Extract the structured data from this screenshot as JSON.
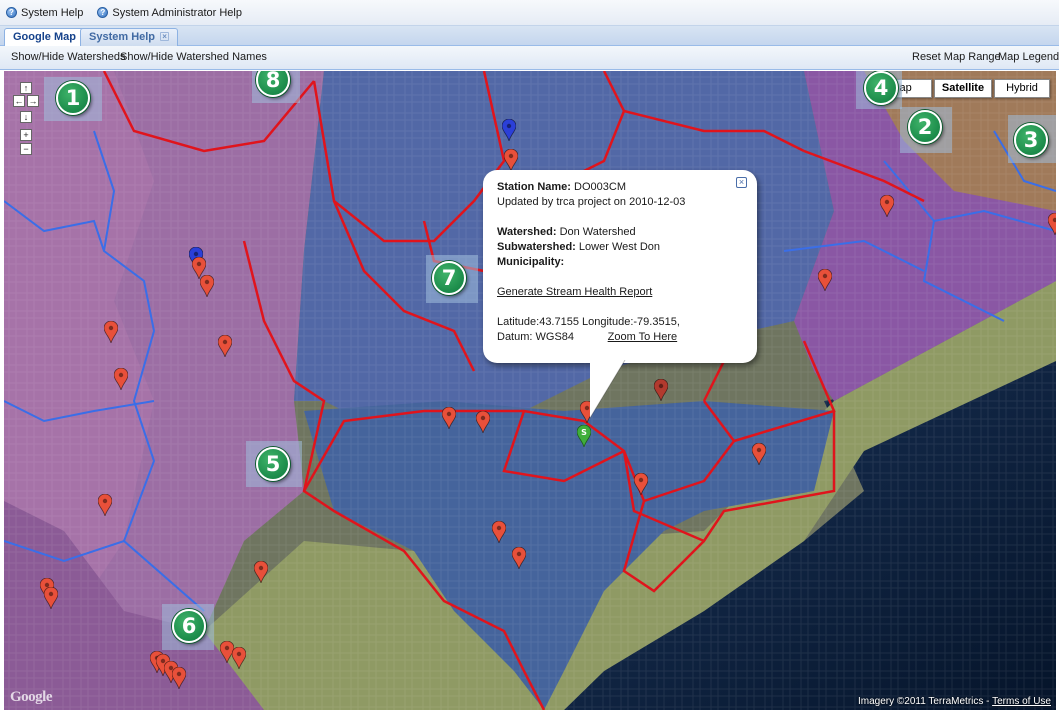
{
  "helpbar": {
    "system_help": "System Help",
    "system_admin_help": "System Administrator Help"
  },
  "tabs": [
    {
      "label": "Google Map",
      "active": true
    },
    {
      "label": "System Help",
      "active": false,
      "closable": true
    }
  ],
  "toolbar": {
    "show_hide_watersheds": "Show/Hide Watersheds",
    "show_hide_names": "Show/Hide Watershed Names",
    "reset_map_range": "Reset Map Range",
    "map_legend": "Map Legend"
  },
  "map_type": {
    "map": "Map",
    "satellite": "Satellite",
    "hybrid": "Hybrid",
    "selected": "Satellite"
  },
  "nav": {
    "up": "↑",
    "left": "←",
    "right": "→",
    "down": "↓",
    "zoom_in": "+",
    "zoom_out": "−"
  },
  "info_window": {
    "station_name_label": "Station Name:",
    "station_name": "DO003CM",
    "updated": "Updated by trca project on 2010-12-03",
    "watershed_label": "Watershed:",
    "watershed": "Don Watershed",
    "subwatershed_label": "Subwatershed:",
    "subwatershed": "Lower West Don",
    "municipality_label": "Municipality:",
    "municipality": "",
    "report_link": "Generate Stream Health Report",
    "lat_lon": "Latitude:43.7155 Longitude:-79.3515,",
    "datum": "Datum: WGS84",
    "zoom_link": "Zoom To Here",
    "close": "×"
  },
  "callouts": [
    "1",
    "2",
    "3",
    "4",
    "5",
    "6",
    "7",
    "8"
  ],
  "selected_marker_letter": "S",
  "footer": {
    "imagery": "Imagery ©2011 TerraMetrics - ",
    "terms": "Terms of Use",
    "logo": "Google"
  },
  "colors": {
    "watershed_border": "#e0141c",
    "subwatershed_border": "#3a6ee8",
    "marker_red": "#e8503a",
    "marker_blue": "#2b3fd8",
    "marker_green": "#3fae3a",
    "callout_green": "#0c7a3c",
    "lake": "#0a1d3a"
  }
}
